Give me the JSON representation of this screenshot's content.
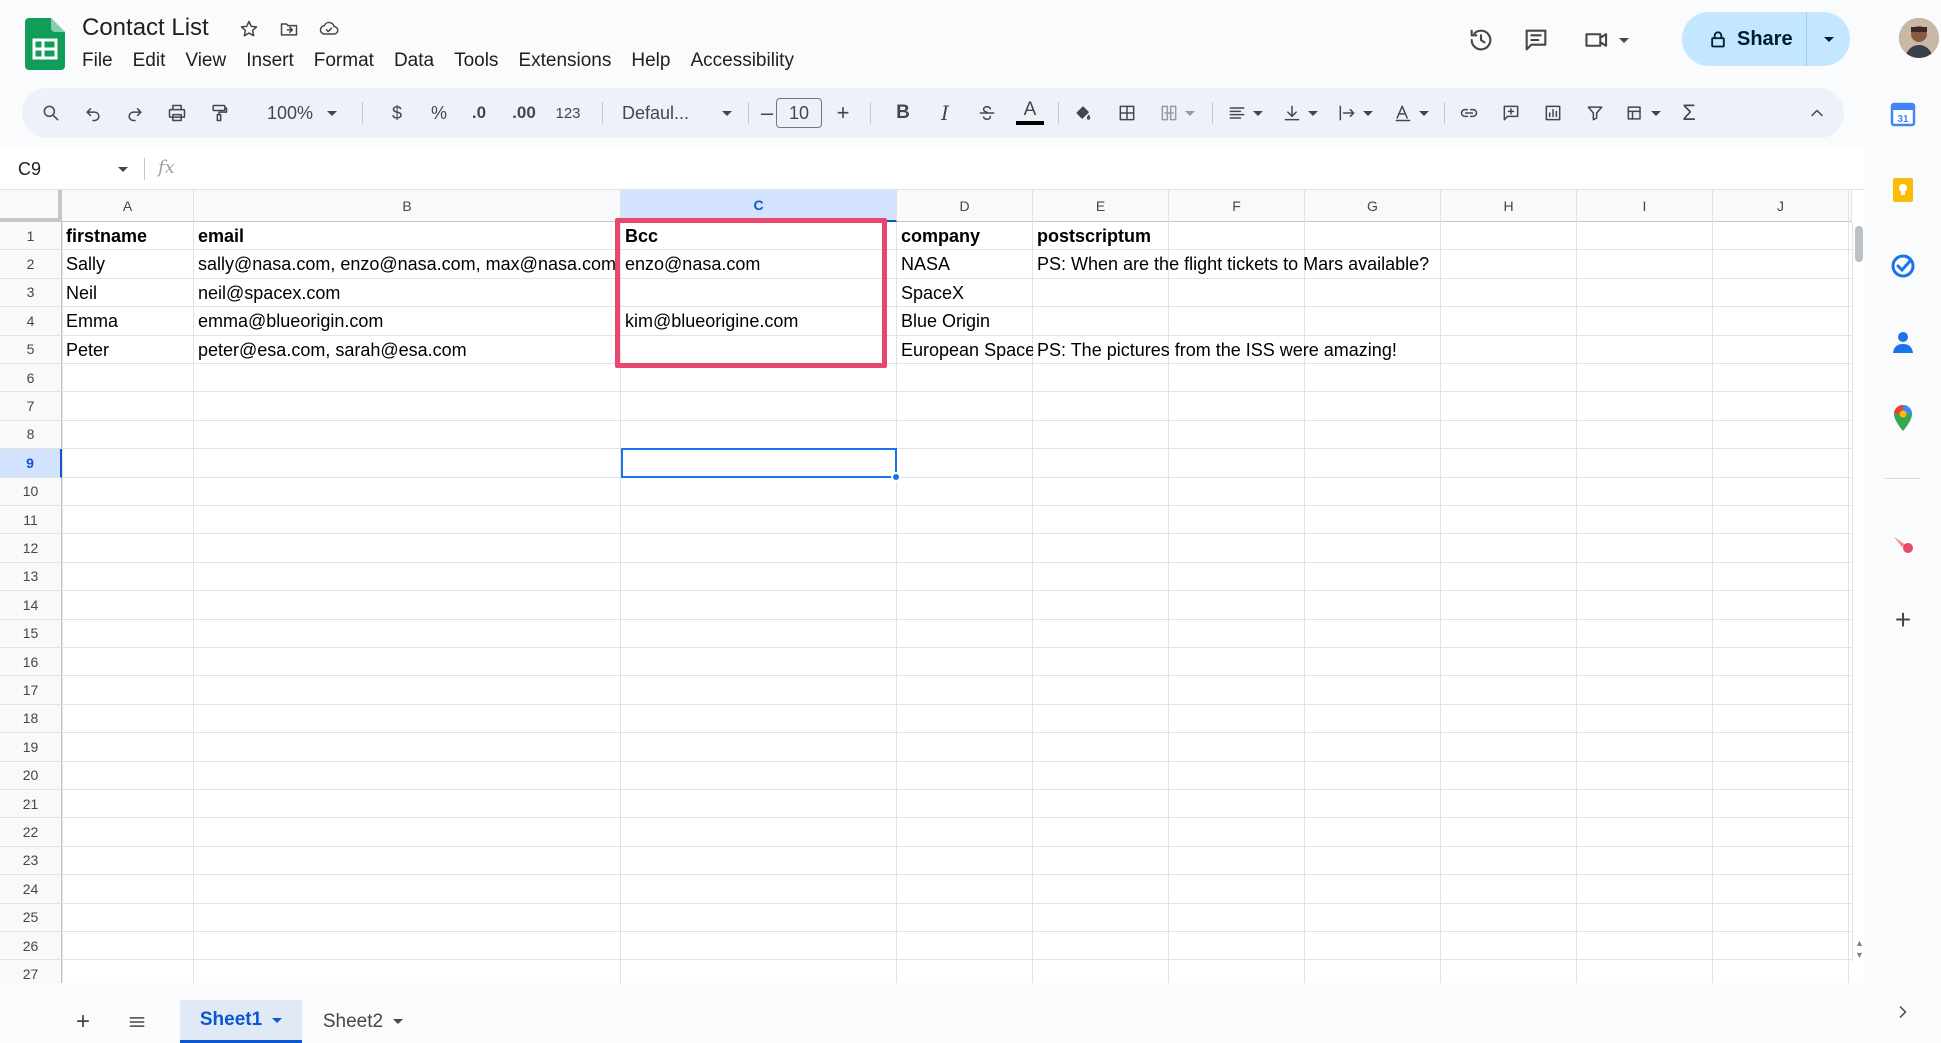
{
  "app": {
    "title": "Contact List",
    "menu": [
      "File",
      "Edit",
      "View",
      "Insert",
      "Format",
      "Data",
      "Tools",
      "Extensions",
      "Help",
      "Accessibility"
    ],
    "share_label": "Share",
    "brand_color": "#0f9d58",
    "share_bg": "#c2e7ff"
  },
  "toolbar": {
    "zoom": "100%",
    "currency": "$",
    "percent": "%",
    "decrease_decimal": ".0",
    "increase_decimal": ".00",
    "number_format": "123",
    "font": "Defaul...",
    "font_size": "10",
    "bold": "B",
    "italic": "I",
    "text_color_glyph": "A",
    "sum": "Σ"
  },
  "formula_bar": {
    "name_box": "C9",
    "fx": "fx",
    "value": ""
  },
  "grid": {
    "columns": [
      "A",
      "B",
      "C",
      "D",
      "E",
      "F",
      "G",
      "H",
      "I",
      "J"
    ],
    "selected_column": "C",
    "selected_row": "9",
    "rows": [
      "1",
      "2",
      "3",
      "4",
      "5",
      "6",
      "7",
      "8",
      "9",
      "10",
      "11",
      "12",
      "13",
      "14",
      "15",
      "16",
      "17",
      "18",
      "19",
      "20",
      "21",
      "22",
      "23",
      "24",
      "25",
      "26",
      "27"
    ],
    "cells": {
      "A1": "firstname",
      "B1": "email",
      "C1": "Bcc",
      "D1": "company",
      "E1": "postscriptum",
      "A2": "Sally",
      "B2": "sally@nasa.com, enzo@nasa.com, max@nasa.com",
      "C2": "enzo@nasa.com",
      "D2": "NASA",
      "E2": "PS: When are the flight tickets to Mars available?",
      "A3": "Neil",
      "B3": "neil@spacex.com",
      "D3": "SpaceX",
      "A4": "Emma",
      "B4": "emma@blueorigin.com",
      "C4": "kim@blueorigine.com",
      "D4": "Blue Origin",
      "A5": "Peter",
      "B5": "peter@esa.com, sarah@esa.com",
      "D5": "European Space",
      "E5": "PS: The pictures from the ISS were amazing!"
    },
    "highlight_color": "#e8476f",
    "selection_color": "#1a73e8"
  },
  "sheets": {
    "tabs": [
      "Sheet1",
      "Sheet2"
    ],
    "active": "Sheet1"
  },
  "side_panel": {
    "apps": [
      "calendar-icon",
      "keep-icon",
      "tasks-icon",
      "contacts-icon",
      "maps-icon",
      "addon-icon",
      "add-icon"
    ]
  }
}
